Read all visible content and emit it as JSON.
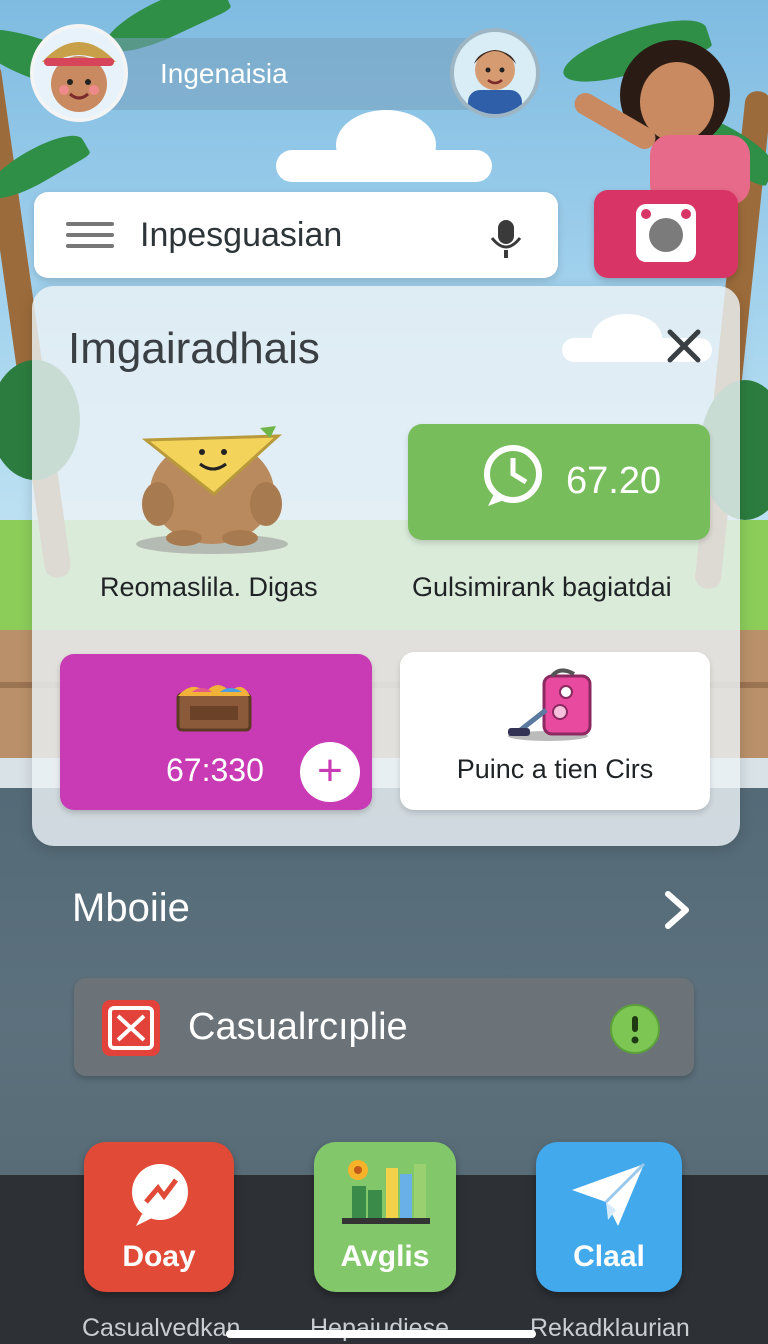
{
  "header": {
    "title": "Ingenaisia"
  },
  "search": {
    "text": "Inpesguasian"
  },
  "panel": {
    "title": "Imgairadhais",
    "green_card": {
      "value": "67.20",
      "caption": "Gulsimirank bagiatdai"
    },
    "mascot_card": {
      "caption": "Reomaslila. Digas"
    },
    "magenta_card": {
      "value": "67:330",
      "plus": "+"
    },
    "white_card": {
      "label": "Puinc a tien Cirs"
    }
  },
  "section": {
    "title": "Mboiie"
  },
  "notice": {
    "text": "Casualrcıplie"
  },
  "apps": [
    {
      "label": "Doay",
      "caption": "Casualvedkan",
      "color": "#e04a36"
    },
    {
      "label": "Avglis",
      "caption": "Hepaiudiese",
      "color": "#82c86a"
    },
    {
      "label": "Claal",
      "caption": "Rekadklaurian",
      "color": "#42a9ec"
    }
  ],
  "colors": {
    "camera": "#d83566",
    "green": "#78bd5c",
    "magenta": "#c83bb4"
  }
}
